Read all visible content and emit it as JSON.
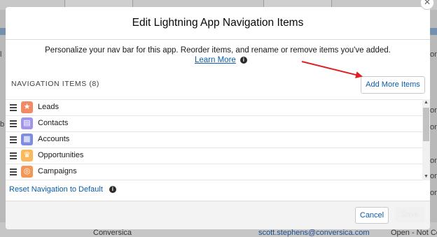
{
  "modal": {
    "title": "Edit Lightning App Navigation Items",
    "intro": "Personalize your nav bar for this app. Reorder items, and rename or remove items you've added.",
    "learn_more": "Learn More",
    "section_label": "NAVIGATION ITEMS (8)",
    "add_more_button": "Add More Items",
    "items": [
      {
        "label": "Leads",
        "icon": "leads-icon",
        "color": "#f38a66"
      },
      {
        "label": "Contacts",
        "icon": "contacts-icon",
        "color": "#a094ed"
      },
      {
        "label": "Accounts",
        "icon": "accounts-icon",
        "color": "#7f8de1"
      },
      {
        "label": "Opportunities",
        "icon": "opportunities-icon",
        "color": "#fcb95b"
      },
      {
        "label": "Campaigns",
        "icon": "campaigns-icon",
        "color": "#f49756"
      }
    ],
    "reset_link": "Reset Navigation to Default",
    "cancel_button": "Cancel",
    "save_button": "Save"
  },
  "background": {
    "row_company": "Conversica",
    "row_email": "scott.stephens@conversica.com",
    "row_status": "Open - Not Con",
    "edge_texts": [
      "b",
      "l",
      "on",
      "on",
      "on",
      "on",
      "on",
      "on"
    ]
  },
  "colors": {
    "link": "#0b5cab",
    "annotation_arrow": "#e02020"
  }
}
